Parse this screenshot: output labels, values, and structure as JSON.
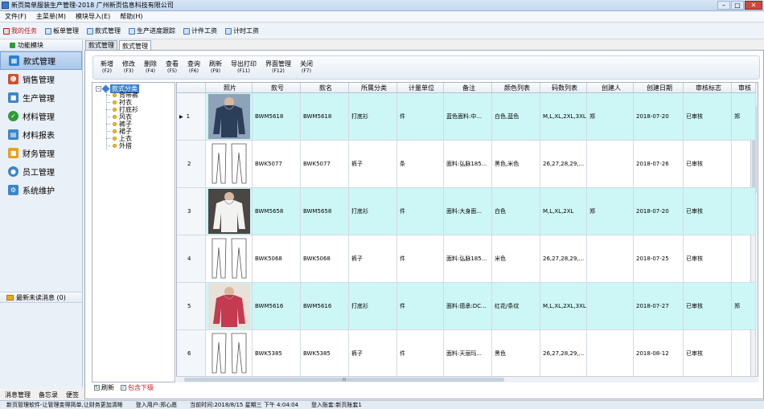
{
  "window": {
    "title": "新页简单服装生产管理-2018 广州新页信息科技有限公司"
  },
  "menu": [
    "文件(F)",
    "主菜单(M)",
    "模块导入(E)",
    "帮助(H)"
  ],
  "quickbar": [
    "我的任务",
    "板单管理",
    "款式管理",
    "生产进度跟踪",
    "计件工资",
    "计时工资"
  ],
  "nav": {
    "header": "功能模块",
    "items": [
      {
        "label": "款式管理",
        "color": "#2f7fd3"
      },
      {
        "label": "销售管理",
        "color": "#d14f2c"
      },
      {
        "label": "生产管理",
        "color": "#3b86c8"
      },
      {
        "label": "材料管理",
        "color": "#2f9a3b"
      },
      {
        "label": "材料报表",
        "color": "#3b86c8"
      },
      {
        "label": "财务管理",
        "color": "#e8a21a"
      },
      {
        "label": "员工管理",
        "color": "#3b86c8"
      },
      {
        "label": "系统维护",
        "color": "#3b86c8"
      }
    ],
    "messages": "最新未读消息 (0)",
    "bottom": [
      "消息管理",
      "备忘录",
      "便签"
    ]
  },
  "tabs": [
    "款式管理",
    "款式管理"
  ],
  "actions": [
    {
      "label": "新增",
      "key": "(F2)"
    },
    {
      "label": "修改",
      "key": "(F3)"
    },
    {
      "label": "删除",
      "key": "(F4)"
    },
    {
      "label": "查看",
      "key": "(F5)"
    },
    {
      "label": "查询",
      "key": "(F6)"
    },
    {
      "label": "刷新",
      "key": "(F9)"
    },
    {
      "label": "导出打印",
      "key": "(F11)"
    },
    {
      "label": "界面管理",
      "key": "(F12)"
    },
    {
      "label": "关闭",
      "key": "(F7)"
    }
  ],
  "tree": {
    "root": "款式分类",
    "children": [
      "背带裤",
      "衬衣",
      "打底衫",
      "风衣",
      "裤子",
      "裙子",
      "上衣",
      "外搭"
    ]
  },
  "tree_footer": {
    "refresh": "刷新",
    "include_sub": "包含下级"
  },
  "grid": {
    "columns": [
      "",
      "照片",
      "款号",
      "款名",
      "所属分类",
      "计量单位",
      "备注",
      "颜色列表",
      "码数列表",
      "创建人",
      "创建日期",
      "审核标志",
      "审核"
    ],
    "rows": [
      {
        "no": "1",
        "code": "BWM5618",
        "name": "BWM5618",
        "category": "打底衫",
        "unit": "件",
        "note": "蓝色面料:中...",
        "colors": "白色,蓝色",
        "sizes": "M,L,XL,2XL,3XL",
        "creator": "郑",
        "date": "2018-07-20",
        "audit": "已审核",
        "auditor": "郑",
        "photo": "shirt-blue"
      },
      {
        "no": "2",
        "code": "BWK5077",
        "name": "BWK5077",
        "category": "裤子",
        "unit": "条",
        "note": "面料:弘脉185...",
        "colors": "黑色,米色",
        "sizes": "26,27,28,29,...",
        "creator": "",
        "date": "2018-07-26",
        "audit": "已审核",
        "auditor": "",
        "photo": "pants-sketch"
      },
      {
        "no": "3",
        "code": "BWM5658",
        "name": "BWM5658",
        "category": "打底衫",
        "unit": "件",
        "note": "面料:大身面...",
        "colors": "白色",
        "sizes": "M,L,XL,2XL",
        "creator": "郑",
        "date": "2018-07-20",
        "audit": "已审核",
        "auditor": "",
        "photo": "shirt-white"
      },
      {
        "no": "4",
        "code": "BWK5068",
        "name": "BWK5068",
        "category": "裤子",
        "unit": "件",
        "note": "面料:弘脉185...",
        "colors": "米色",
        "sizes": "26,27,28,29,...",
        "creator": "",
        "date": "2018-07-25",
        "audit": "已审核",
        "auditor": "",
        "photo": "pants-sketch"
      },
      {
        "no": "5",
        "code": "BWM5616",
        "name": "BWM5616",
        "category": "打底衫",
        "unit": "件",
        "note": "面料:德承:DC...",
        "colors": "红花/条纹",
        "sizes": "M,L,XL,2XL,3XL",
        "creator": "",
        "date": "2018-07-27",
        "audit": "已审核",
        "auditor": "郑",
        "photo": "shirt-red"
      },
      {
        "no": "6",
        "code": "BWK5385",
        "name": "BWK5385",
        "category": "裤子",
        "unit": "件",
        "note": "面料:天丽玛...",
        "colors": "黑色",
        "sizes": "26,27,28,29,...",
        "creator": "",
        "date": "2018-08-12",
        "audit": "已审核",
        "auditor": "",
        "photo": "pants-sketch"
      }
    ],
    "hscroll_grip": "III"
  },
  "status": [
    "新页管理软件-让管理变得简单,让财务更加清晰",
    "登入用户:郑心愿",
    "当前时间:2018/8/15 星期三 下午 4:04:04",
    "登入账套:新页账套1"
  ]
}
